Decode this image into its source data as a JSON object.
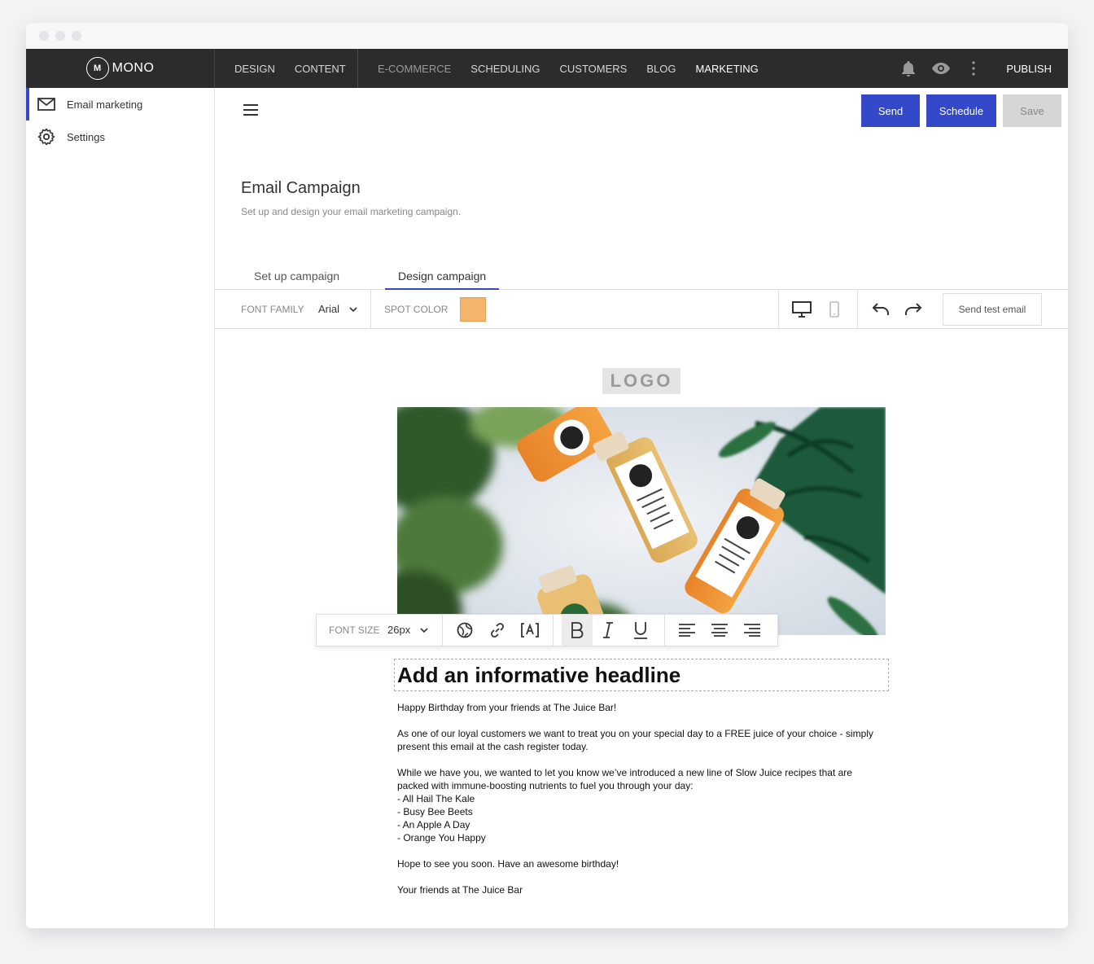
{
  "brand": {
    "name": "MONO",
    "logo_mark": "M"
  },
  "topnav": {
    "primary": [
      "DESIGN",
      "CONTENT"
    ],
    "apps": [
      "E-COMMERCE",
      "SCHEDULING",
      "CUSTOMERS",
      "BLOG",
      "MARKETING"
    ],
    "active": "MARKETING",
    "publish": "PUBLISH"
  },
  "sidebar": {
    "items": [
      {
        "label": "Email marketing",
        "icon": "mail-icon",
        "active": true
      },
      {
        "label": "Settings",
        "icon": "gear-icon",
        "active": false
      }
    ]
  },
  "actions": {
    "send": "Send",
    "schedule": "Schedule",
    "save": "Save"
  },
  "page": {
    "title": "Email Campaign",
    "subtitle": "Set up and design your email marketing campaign."
  },
  "tabs": [
    {
      "label": "Set up campaign",
      "active": false
    },
    {
      "label": "Design campaign",
      "active": true
    }
  ],
  "toolbar": {
    "font_family_label": "FONT FAMILY",
    "font_family_value": "Arial",
    "spot_color_label": "SPOT COLOR",
    "spot_color": "#f5b46b",
    "send_test": "Send test email"
  },
  "email": {
    "logo_placeholder": "LOGO",
    "format_bar": {
      "font_size_label": "FONT SIZE",
      "font_size_value": "26px"
    },
    "headline": "Add an informative headline",
    "paragraphs": [
      [
        "Happy Birthday from your friends at The Juice Bar!"
      ],
      [
        "As one of our loyal customers we want to treat you on your special day to a FREE juice of your choice - simply present this email at the cash register today."
      ],
      [
        "While we have you, we wanted to let you know we’ve introduced a new line of Slow Juice recipes that are packed with immune-boosting nutrients to fuel you through your day:",
        "- All Hail The Kale",
        "- Busy Bee Beets",
        "- An Apple A Day",
        "- Orange You Happy"
      ],
      [
        "Hope to see you soon. Have an awesome birthday!"
      ],
      [
        "Your friends at The Juice Bar"
      ]
    ]
  },
  "colors": {
    "accent": "#3349c9",
    "nav_bg": "#2c2c2c"
  }
}
